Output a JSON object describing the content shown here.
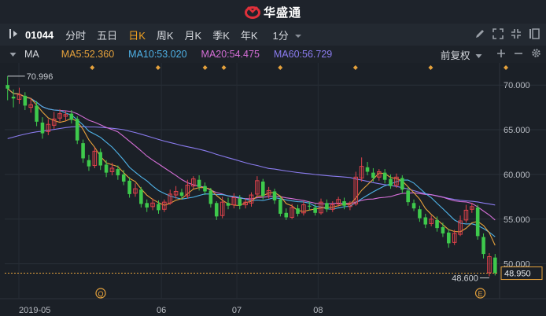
{
  "brand": {
    "name": "华盛通"
  },
  "toolbar": {
    "symbol": "01044",
    "periods": [
      "分时",
      "五日",
      "日K",
      "周K",
      "月K",
      "季K",
      "年K"
    ],
    "active_period": "日K",
    "interval": "1分",
    "icons": [
      "pen-icon",
      "expand-icon",
      "shrink-icon",
      "layout-icon"
    ]
  },
  "ma_bar": {
    "indicator": "MA",
    "ma5": "MA5:52.360",
    "ma10": "MA10:53.020",
    "ma20": "MA20:54.475",
    "ma60": "MA60:56.729",
    "adjust": "前复权",
    "colors": {
      "ma5": "#e6a23c",
      "ma10": "#4fb3e8",
      "ma20": "#d66fd8",
      "ma60": "#8b7cf0",
      "up": "#e0424b",
      "down": "#3ec94c"
    }
  },
  "chart_data": {
    "type": "candlestick",
    "y_ticks": [
      "70.000",
      "65.000",
      "60.000",
      "55.000",
      "50.000"
    ],
    "ylim": [
      46.8,
      71.6
    ],
    "x_ticks": [
      "2019-05",
      "06",
      "07",
      "08"
    ],
    "max_label": "70.996",
    "min_label": "48.600",
    "last_price": "48.950",
    "event_markers": [
      "Q",
      "E"
    ],
    "candles": [
      [
        70.0,
        69.6,
        71.0,
        68.3
      ],
      [
        68.7,
        68.5,
        69.5,
        67.5
      ],
      [
        68.4,
        68.9,
        69.7,
        67.9
      ],
      [
        68.8,
        67.7,
        69.2,
        67.2
      ],
      [
        67.5,
        67.8,
        68.5,
        66.9
      ],
      [
        67.7,
        65.9,
        68.2,
        65.4
      ],
      [
        65.8,
        64.6,
        66.4,
        64.0
      ],
      [
        64.8,
        65.6,
        66.2,
        64.4
      ],
      [
        65.5,
        66.2,
        67.0,
        65.1
      ],
      [
        66.3,
        66.8,
        67.3,
        65.9
      ],
      [
        66.5,
        66.7,
        67.1,
        66.0
      ],
      [
        66.8,
        66.1,
        67.2,
        65.7
      ],
      [
        66.2,
        63.8,
        66.5,
        63.4
      ],
      [
        63.5,
        61.8,
        63.9,
        61.3
      ],
      [
        61.6,
        60.9,
        62.2,
        60.4
      ],
      [
        61.0,
        62.6,
        63.0,
        60.7
      ],
      [
        62.5,
        61.0,
        62.9,
        60.5
      ],
      [
        61.1,
        60.2,
        61.6,
        59.7
      ],
      [
        60.3,
        60.7,
        61.3,
        59.9
      ],
      [
        60.6,
        59.9,
        61.0,
        59.4
      ],
      [
        60.0,
        59.2,
        60.5,
        58.8
      ],
      [
        59.3,
        57.8,
        59.7,
        57.4
      ],
      [
        57.9,
        58.4,
        59.0,
        57.5
      ],
      [
        58.3,
        56.7,
        58.6,
        56.3
      ],
      [
        56.8,
        56.3,
        57.2,
        55.8
      ],
      [
        56.4,
        56.8,
        57.3,
        56.0
      ],
      [
        56.7,
        56.0,
        57.1,
        55.6
      ],
      [
        56.1,
        56.9,
        57.2,
        55.8
      ],
      [
        56.8,
        57.8,
        58.3,
        56.6
      ],
      [
        57.7,
        58.1,
        58.7,
        57.3
      ],
      [
        58.0,
        57.6,
        58.4,
        57.2
      ],
      [
        57.6,
        58.8,
        59.4,
        57.3
      ],
      [
        58.7,
        59.5,
        59.8,
        58.4
      ],
      [
        59.4,
        58.6,
        59.9,
        58.2
      ],
      [
        58.7,
        58.1,
        59.1,
        57.7
      ],
      [
        58.2,
        56.7,
        58.5,
        56.3
      ],
      [
        56.8,
        55.3,
        57.0,
        54.9
      ],
      [
        55.4,
        56.9,
        57.5,
        55.1
      ],
      [
        56.8,
        56.5,
        57.4,
        56.1
      ],
      [
        56.6,
        57.4,
        57.9,
        56.2
      ],
      [
        57.3,
        56.5,
        57.7,
        56.1
      ],
      [
        56.6,
        56.9,
        57.3,
        56.2
      ],
      [
        56.8,
        57.7,
        58.0,
        56.4
      ],
      [
        57.8,
        59.3,
        59.8,
        57.5
      ],
      [
        59.2,
        57.6,
        59.5,
        57.2
      ],
      [
        57.7,
        58.2,
        58.6,
        57.3
      ],
      [
        58.1,
        57.1,
        58.4,
        56.7
      ],
      [
        57.2,
        55.6,
        57.5,
        55.3
      ],
      [
        55.7,
        55.2,
        56.2,
        54.9
      ],
      [
        55.2,
        56.3,
        56.7,
        55.0
      ],
      [
        56.2,
        55.6,
        56.6,
        55.3
      ],
      [
        55.7,
        56.6,
        57.0,
        55.4
      ],
      [
        56.5,
        56.4,
        57.0,
        56.0
      ],
      [
        56.3,
        55.7,
        56.7,
        55.4
      ],
      [
        55.7,
        56.9,
        57.3,
        55.5
      ],
      [
        56.8,
        56.1,
        57.2,
        55.8
      ],
      [
        56.1,
        56.6,
        57.0,
        55.8
      ],
      [
        56.7,
        57.2,
        57.5,
        56.4
      ],
      [
        57.0,
        56.5,
        57.4,
        56.1
      ],
      [
        56.4,
        56.8,
        57.0,
        56.0
      ],
      [
        56.7,
        59.7,
        60.3,
        56.5
      ],
      [
        59.6,
        60.9,
        61.9,
        59.2
      ],
      [
        60.8,
        60.3,
        61.4,
        59.9
      ],
      [
        60.2,
        59.6,
        60.7,
        59.2
      ],
      [
        59.7,
        60.3,
        60.6,
        59.3
      ],
      [
        60.2,
        59.4,
        60.6,
        59.0
      ],
      [
        59.5,
        58.7,
        60.0,
        58.4
      ],
      [
        58.8,
        59.7,
        60.1,
        58.5
      ],
      [
        59.6,
        58.3,
        59.9,
        57.9
      ],
      [
        58.2,
        56.9,
        58.6,
        56.5
      ],
      [
        56.8,
        56.2,
        57.2,
        55.9
      ],
      [
        56.1,
        55.1,
        56.5,
        54.7
      ],
      [
        55.2,
        54.4,
        55.6,
        54.0
      ],
      [
        54.5,
        55.0,
        55.4,
        54.2
      ],
      [
        54.9,
        54.0,
        55.3,
        53.6
      ],
      [
        54.1,
        53.4,
        54.6,
        53.0
      ],
      [
        53.5,
        52.3,
        53.9,
        51.8
      ],
      [
        52.4,
        53.4,
        53.8,
        52.1
      ],
      [
        53.3,
        54.8,
        55.4,
        53.1
      ],
      [
        54.9,
        56.0,
        56.6,
        54.6
      ],
      [
        56.1,
        56.4,
        56.8,
        55.7
      ],
      [
        56.3,
        53.1,
        56.6,
        52.7
      ],
      [
        53.0,
        51.1,
        53.4,
        50.6
      ],
      [
        49.0,
        50.8,
        51.2,
        48.6
      ],
      [
        50.7,
        48.95,
        51.1,
        48.7
      ]
    ]
  }
}
